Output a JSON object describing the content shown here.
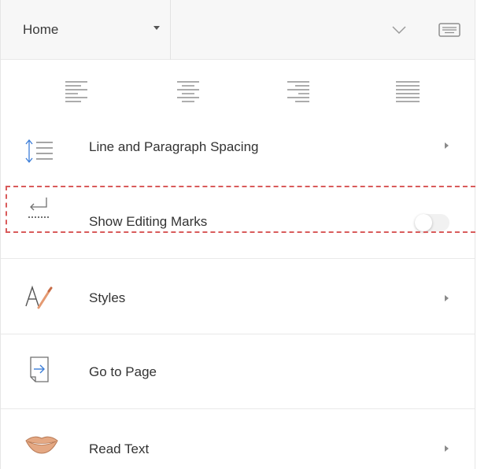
{
  "ribbon": {
    "tab_selected": "Home"
  },
  "icons": {
    "collapse": "chevron-down-icon",
    "keyboard": "keyboard-icon",
    "align_left": "align-left-icon",
    "align_center": "align-center-icon",
    "align_right": "align-right-icon",
    "justify": "justify-icon",
    "spacing": "line-spacing-icon",
    "editing_marks": "return-arrow-icon",
    "styles": "styles-icon",
    "goto": "go-to-page-icon",
    "read": "lips-icon"
  },
  "menu": {
    "line_spacing": {
      "label": "Line and Paragraph Spacing"
    },
    "show_editing_marks": {
      "label": "Show Editing Marks",
      "toggle_on": false
    },
    "styles": {
      "label": "Styles"
    },
    "go_to_page": {
      "label": "Go to Page"
    },
    "read_text": {
      "label": "Read Text"
    }
  },
  "colors": {
    "accent_blue": "#3b7dd8",
    "highlight_dash": "#d95b5b",
    "styles_pen": "#e49a72",
    "lips": "#e4a883"
  }
}
